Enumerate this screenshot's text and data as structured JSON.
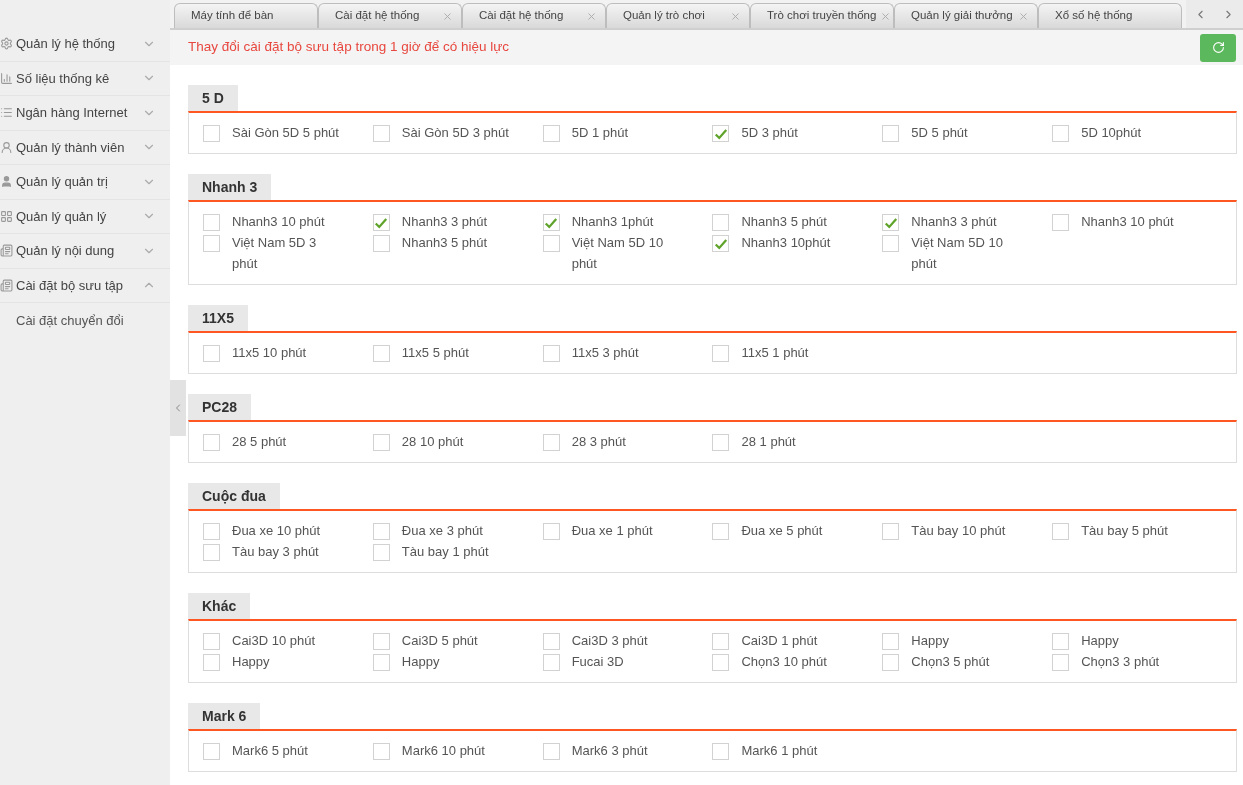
{
  "sidebar": {
    "items": [
      {
        "label": "Quản lý hệ thống",
        "kind": "gear",
        "expanded": false
      },
      {
        "label": "Số liệu thống kê",
        "kind": "chart",
        "expanded": false
      },
      {
        "label": "Ngân hàng Internet",
        "kind": "list",
        "expanded": false
      },
      {
        "label": "Quản lý thành viên",
        "kind": "useroutline",
        "expanded": false
      },
      {
        "label": "Quản lý quản trị",
        "kind": "user",
        "expanded": false
      },
      {
        "label": "Quản lý quản lý",
        "kind": "grid",
        "expanded": false
      },
      {
        "label": "Quản lý nội dung",
        "kind": "doc",
        "expanded": false
      },
      {
        "label": "Cài đặt bộ sưu tập",
        "kind": "doc",
        "expanded": true,
        "children": [
          {
            "label": "Cài đặt chuyển đổi"
          }
        ]
      }
    ]
  },
  "tabs": [
    {
      "label": "Máy tính để bàn",
      "closable": false
    },
    {
      "label": "Cài đặt hệ thống",
      "closable": true
    },
    {
      "label": "Cài đặt hệ thống",
      "closable": true
    },
    {
      "label": "Quản lý trò chơi",
      "closable": true
    },
    {
      "label": "Trò chơi truyền thống",
      "closable": true
    },
    {
      "label": "Quản lý giải thưởng",
      "closable": true
    },
    {
      "label": "Xổ số hệ thống",
      "closable": false
    }
  ],
  "notice": "Thay đổi cài đặt bộ sưu tập trong 1 giờ để có hiệu lực",
  "sections": [
    {
      "title": "5 D",
      "options": [
        {
          "label": "Sài Gòn 5D 5 phút",
          "checked": false
        },
        {
          "label": "Sài Gòn 5D 3 phút",
          "checked": false
        },
        {
          "label": "5D 1 phút",
          "checked": false
        },
        {
          "label": "5D 3 phút",
          "checked": true
        },
        {
          "label": "5D 5 phút",
          "checked": false
        },
        {
          "label": "5D 10phút",
          "checked": false
        }
      ]
    },
    {
      "title": "Nhanh 3",
      "options": [
        {
          "label": "Nhanh3 10 phút",
          "checked": false
        },
        {
          "label": "Nhanh3 3 phút",
          "checked": true
        },
        {
          "label": "Nhanh3 1phút",
          "checked": true
        },
        {
          "label": "Nhanh3 5 phút",
          "checked": false
        },
        {
          "label": "Nhanh3 3 phút",
          "checked": true
        },
        {
          "label": "Nhanh3 10 phút",
          "checked": false
        },
        {
          "label": "Việt Nam 5D 3 phút",
          "checked": false
        },
        {
          "label": "Nhanh3 5 phút",
          "checked": false
        },
        {
          "label": "Việt Nam 5D 10 phút",
          "checked": false
        },
        {
          "label": "Nhanh3 10phút",
          "checked": true
        },
        {
          "label": "Việt Nam 5D 10 phút",
          "checked": false
        }
      ]
    },
    {
      "title": "11X5",
      "options": [
        {
          "label": "11x5 10 phút",
          "checked": false
        },
        {
          "label": "11x5 5 phút",
          "checked": false
        },
        {
          "label": "11x5 3 phút",
          "checked": false
        },
        {
          "label": "11x5 1 phút",
          "checked": false
        }
      ]
    },
    {
      "title": "PC28",
      "options": [
        {
          "label": "28 5 phút",
          "checked": false
        },
        {
          "label": "28 10 phút",
          "checked": false
        },
        {
          "label": "28 3 phút",
          "checked": false
        },
        {
          "label": "28 1 phút",
          "checked": false
        }
      ]
    },
    {
      "title": "Cuộc đua",
      "options": [
        {
          "label": "Đua xe 10 phút",
          "checked": false
        },
        {
          "label": "Đua xe 3 phút",
          "checked": false
        },
        {
          "label": "Đua xe 1 phút",
          "checked": false
        },
        {
          "label": "Đua xe 5 phút",
          "checked": false
        },
        {
          "label": "Tàu bay 10 phút",
          "checked": false
        },
        {
          "label": "Tàu bay 5 phút",
          "checked": false
        },
        {
          "label": "Tàu bay 3 phút",
          "checked": false
        },
        {
          "label": "Tàu bay 1 phút",
          "checked": false
        }
      ]
    },
    {
      "title": "Khác",
      "options": [
        {
          "label": "Cai3D 10 phút",
          "checked": false
        },
        {
          "label": "Cai3D 5 phút",
          "checked": false
        },
        {
          "label": "Cai3D 3 phút",
          "checked": false
        },
        {
          "label": "Cai3D 1 phút",
          "checked": false
        },
        {
          "label": "Happy",
          "checked": false
        },
        {
          "label": "Happy",
          "checked": false
        },
        {
          "label": "Happy",
          "checked": false
        },
        {
          "label": "Happy",
          "checked": false
        },
        {
          "label": "Fucai 3D",
          "checked": false
        },
        {
          "label": "Chọn3 10 phút",
          "checked": false
        },
        {
          "label": "Chọn3 5 phút",
          "checked": false
        },
        {
          "label": "Chọn3 3 phút",
          "checked": false
        }
      ]
    },
    {
      "title": "Mark 6",
      "options": [
        {
          "label": "Mark6 5 phút",
          "checked": false
        },
        {
          "label": "Mark6 10 phút",
          "checked": false
        },
        {
          "label": "Mark6 3 phút",
          "checked": false
        },
        {
          "label": "Mark6 1 phút",
          "checked": false
        }
      ]
    }
  ]
}
